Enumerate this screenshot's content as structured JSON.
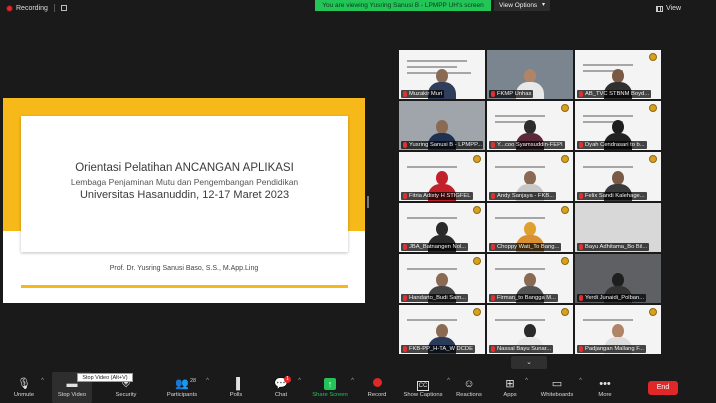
{
  "topbar": {
    "recording_label": "Recording",
    "banner_text": "You are viewing Yusring Sanusi B - LPMPP UH's screen",
    "view_options_label": "View Options",
    "view_label": "View"
  },
  "slide": {
    "title_plain": "Orientasi Pelatihan ",
    "title_caps": "ANCANGAN APLIKASI",
    "subtitle": "Lembaga Penjaminan Mutu dan Pengembangan Pendidikan",
    "line3": "Universitas Hasanuddin, 12-17 Maret 2023",
    "presenter": "Prof. Dr. Yusring Sanusi Baso, S.S., M.App.Ling"
  },
  "participants": [
    {
      "name": "Muzakir Muri"
    },
    {
      "name": "FKMP Unhas"
    },
    {
      "name": "AB_TVC STBNM Boyd..."
    },
    {
      "name": "Yusring Sanusi B - LPMPP..."
    },
    {
      "name": "Y...coo Syamsuddin-FEPI"
    },
    {
      "name": "Dyah Cendrasari to b..."
    },
    {
      "name": "Fitria Adisty H STIGFEL"
    },
    {
      "name": "Andy Sanjaya - FKB..."
    },
    {
      "name": "Felix Sandi Kalehage..."
    },
    {
      "name": "JBA_Batnangen Nol..."
    },
    {
      "name": "Choppy Wati_To Bang..."
    },
    {
      "name": "Bayu Adhitama_Bo Bil..."
    },
    {
      "name": "Handarto_Budi Sam..."
    },
    {
      "name": "Firman_to Bangga M..."
    },
    {
      "name": "Yerdi Junaidi_Polban..."
    },
    {
      "name": "FKB-PP_H-TA_W DCDE"
    },
    {
      "name": "Nassal Bayu Sunar..."
    },
    {
      "name": "Padjangan Mallang F..."
    }
  ],
  "toolbar": {
    "unmute": "Unmute",
    "stop_video": "Stop Video",
    "security": "Security",
    "participants": "Participants",
    "participants_count": "28",
    "polls": "Polls",
    "chat": "Chat",
    "chat_badge": "1",
    "share_screen": "Share Screen",
    "record": "Record",
    "show_captions": "Show Captions",
    "reactions": "Reactions",
    "apps": "Apps",
    "whiteboards": "Whiteboards",
    "more": "More",
    "end": "End",
    "tooltip": "Stop Video (Alt+V)"
  },
  "colors": {
    "slide_accent": "#f7b81a",
    "banner_green": "#23c458",
    "end_red": "#e02828"
  }
}
